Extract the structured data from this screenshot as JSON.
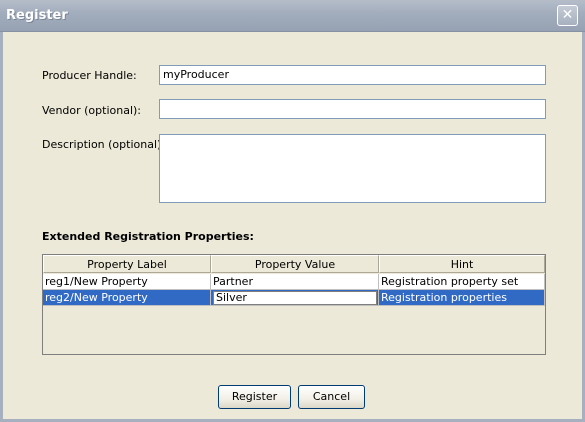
{
  "window": {
    "title": "Register",
    "close_glyph": "✕"
  },
  "form": {
    "producer_handle": {
      "label": "Producer Handle:",
      "value": "myProducer"
    },
    "vendor": {
      "label": "Vendor (optional):",
      "value": ""
    },
    "description": {
      "label": "Description (optional):",
      "value": ""
    }
  },
  "properties": {
    "section_title": "Extended Registration Properties:",
    "columns": [
      "Property Label",
      "Property Value",
      "Hint"
    ],
    "rows": [
      {
        "label": "reg1/New Property",
        "value": "Partner",
        "hint": "Registration property set",
        "selected": false
      },
      {
        "label": "reg2/New Property",
        "value": "Silver",
        "hint": "Registration properties",
        "selected": true
      }
    ]
  },
  "buttons": {
    "register": "Register",
    "cancel": "Cancel"
  },
  "colors": {
    "selection": "#316AC5",
    "dialog_bg": "#ECE9D8"
  }
}
